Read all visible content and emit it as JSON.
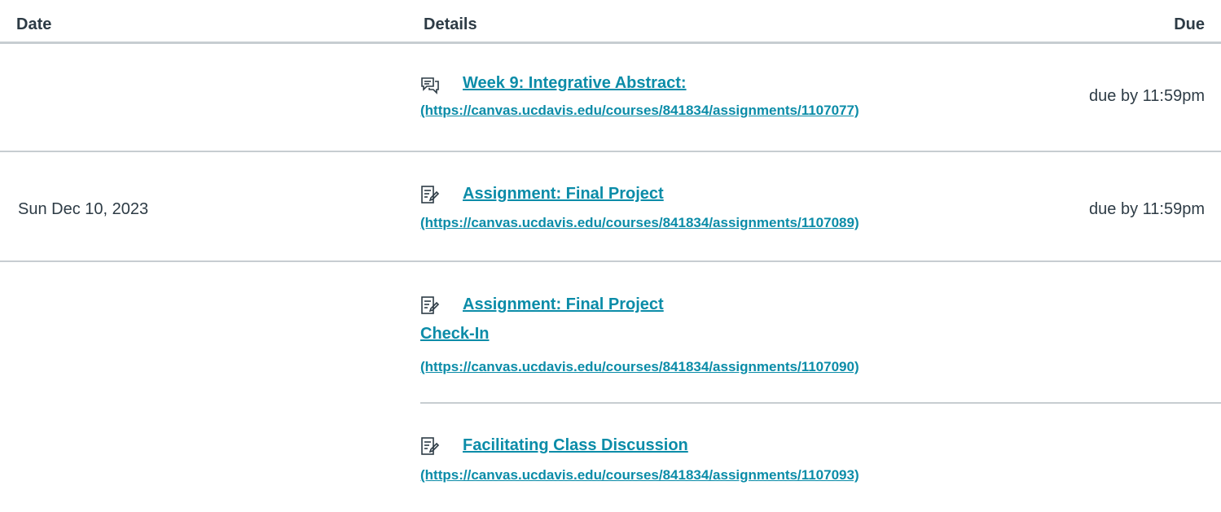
{
  "header": {
    "date": "Date",
    "details": "Details",
    "due": "Due"
  },
  "rows": [
    {
      "date": "",
      "icon": "discussion-icon",
      "title": "Week 9: Integrative Abstract:",
      "url": "(https://canvas.ucdavis.edu/courses/841834/assignments/1107077)",
      "due": "due by 11:59pm"
    },
    {
      "date": "Sun Dec 10, 2023",
      "icon": "assignment-icon",
      "title": "Assignment: Final Project",
      "url": "(https://canvas.ucdavis.edu/courses/841834/assignments/1107089)",
      "due": "due by 11:59pm"
    },
    {
      "date": "",
      "icon": "assignment-icon",
      "title": "Assignment: Final Project",
      "title_line2": "Check-In",
      "url": "(https://canvas.ucdavis.edu/courses/841834/assignments/1107090)",
      "due": ""
    },
    {
      "date": "",
      "icon": "assignment-icon",
      "title": "Facilitating Class Discussion",
      "url": "(https://canvas.ucdavis.edu/courses/841834/assignments/1107093)",
      "due": ""
    }
  ],
  "colors": {
    "link": "#0b8ca8",
    "text": "#2d3b45",
    "rule": "#c7cdd1"
  }
}
